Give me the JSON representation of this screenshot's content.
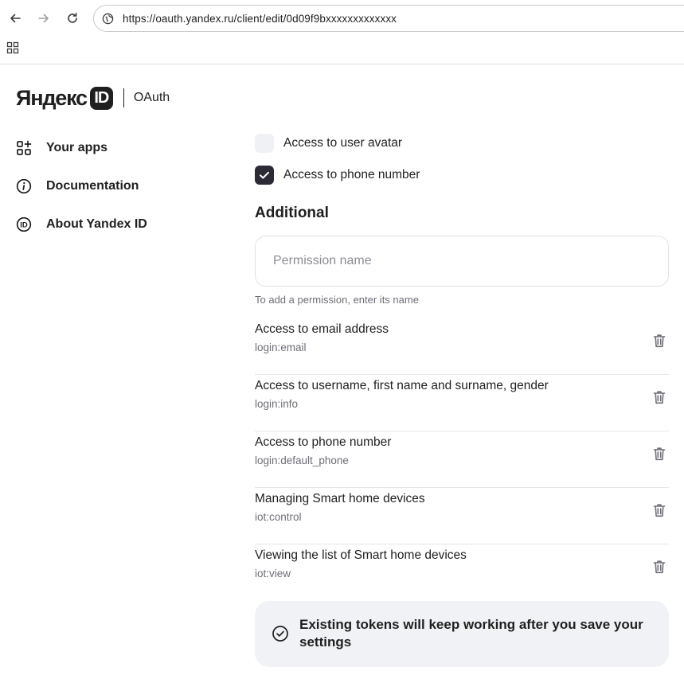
{
  "browser": {
    "url": "https://oauth.yandex.ru/client/edit/0d09f9bxxxxxxxxxxxxx",
    "icons": {
      "back": "arrow-left-icon",
      "forward": "arrow-right-icon",
      "reload": "reload-icon",
      "site": "site-info-icon",
      "apps": "apps-grid-icon"
    }
  },
  "header": {
    "logo_text": "Яндекс",
    "logo_badge": "ID",
    "service": "OAuth"
  },
  "sidebar": {
    "items": [
      {
        "label": "Your apps",
        "icon": "apps-plus-icon"
      },
      {
        "label": "Documentation",
        "icon": "info-icon"
      },
      {
        "label": "About Yandex ID",
        "icon": "id-badge-icon"
      }
    ]
  },
  "main": {
    "checkboxes": [
      {
        "label": "Access to user avatar",
        "checked": false
      },
      {
        "label": "Access to phone number",
        "checked": true
      }
    ],
    "additional": {
      "title": "Additional",
      "input_placeholder": "Permission name",
      "input_value": "",
      "hint": "To add a permission, enter its name"
    },
    "permissions": [
      {
        "title": "Access to email address",
        "code": "login:email"
      },
      {
        "title": "Access to username, first name and surname, gender",
        "code": "login:info"
      },
      {
        "title": "Access to phone number",
        "code": "login:default_phone"
      },
      {
        "title": "Managing Smart home devices",
        "code": "iot:control"
      },
      {
        "title": "Viewing the list of Smart home devices",
        "code": "iot:view"
      }
    ],
    "notice": {
      "text": "Existing tokens will keep working after you save your settings",
      "icon": "check-circle-icon"
    }
  },
  "colors": {
    "text": "#1f1f1f",
    "secondary_text": "#6e6e78",
    "checkbox_checked": "#2b2a35",
    "checkbox_unchecked": "#f0f1f4",
    "notice_bg": "#f1f2f5",
    "divider": "#e6e6ea"
  }
}
